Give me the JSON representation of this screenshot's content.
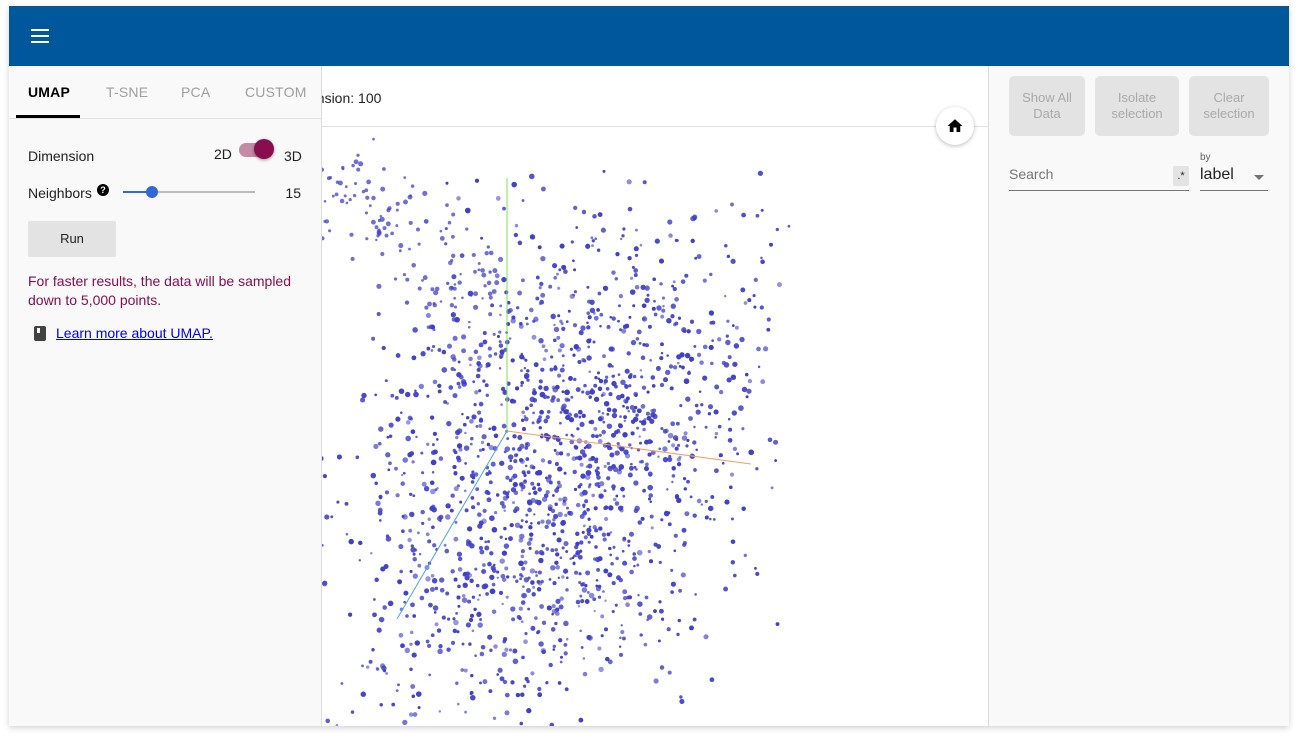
{
  "header": {
    "menu_icon": "hamburger-menu-icon",
    "bg_color": "#01579b"
  },
  "projection_panel": {
    "tabs": [
      {
        "label": "UMAP",
        "active": true
      },
      {
        "label": "T-SNE",
        "active": false
      },
      {
        "label": "PCA",
        "active": false
      },
      {
        "label": "CUSTOM",
        "active": false
      }
    ],
    "dimension": {
      "label": "Dimension",
      "option_left": "2D",
      "option_right": "3D",
      "selected": "3D"
    },
    "neighbors": {
      "label": "Neighbors",
      "help_icon": "?",
      "value": 15,
      "min": 5,
      "max": 50,
      "value_text": "15"
    },
    "run_label": "Run",
    "note": "For faster results, the data will be sampled down to 5,000 points.",
    "learn_more": {
      "icon": "book-icon",
      "label": "Learn more about UMAP."
    }
  },
  "viewer": {
    "dimension_text": "ension: 100",
    "home_icon": "home-icon",
    "point_color": "#3f3fc8",
    "axis_colors": {
      "x": "#f5a05a",
      "y": "#7ee051",
      "z": "#4aa3e8"
    }
  },
  "inspector": {
    "buttons": [
      {
        "label": "Show All Data"
      },
      {
        "label": "Isolate selection"
      },
      {
        "label": "Clear selection"
      }
    ],
    "search": {
      "placeholder": "Search",
      "value": "",
      "regex_label": ".*"
    },
    "by": {
      "label": "by",
      "value": "label"
    }
  }
}
